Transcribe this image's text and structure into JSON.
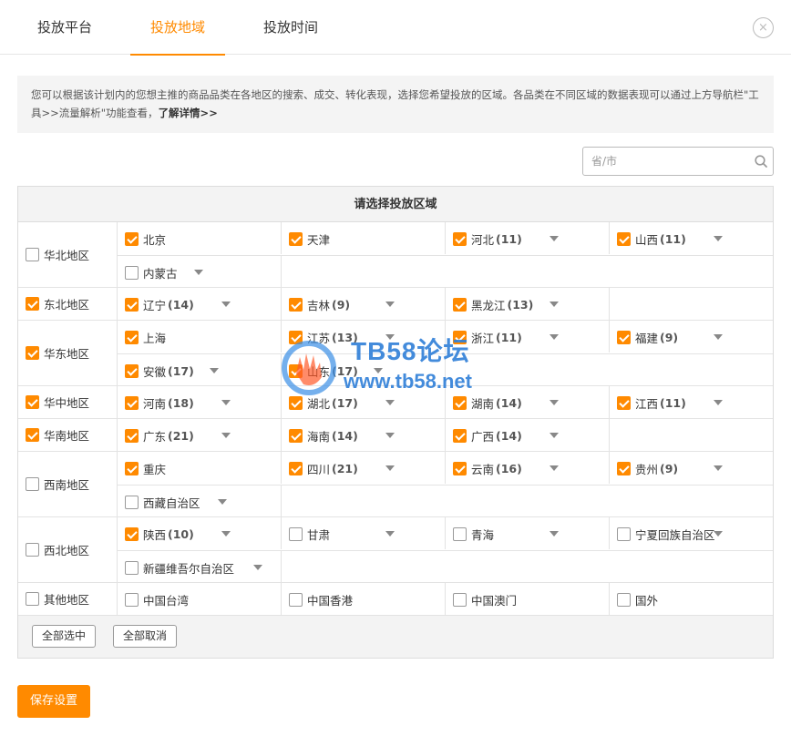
{
  "tabs": [
    {
      "label": "投放平台"
    },
    {
      "label": "投放地域"
    },
    {
      "label": "投放时间"
    }
  ],
  "close_label": "×",
  "notice": {
    "text": "您可以根据该计划内的您想主推的商品品类在各地区的搜索、成交、转化表现，选择您希望投放的区域。各品类在不同区域的数据表现可以通过上方导航栏\"工具>>流量解析\"功能查看，",
    "link": "了解详情>>"
  },
  "search": {
    "placeholder": "省/市",
    "value": ""
  },
  "table": {
    "header": "请选择投放区域",
    "regions": [
      {
        "name": "华北地区",
        "checked": false,
        "provinces": [
          {
            "name": "北京",
            "count": "",
            "checked": true,
            "dropdown": false
          },
          {
            "name": "天津",
            "count": "",
            "checked": true,
            "dropdown": false
          },
          {
            "name": "河北",
            "count": "(11)",
            "checked": true,
            "dropdown": true
          },
          {
            "name": "山西",
            "count": "(11)",
            "checked": true,
            "dropdown": true
          },
          {
            "name": "内蒙古",
            "count": "",
            "checked": false,
            "dropdown": true
          }
        ]
      },
      {
        "name": "东北地区",
        "checked": true,
        "provinces": [
          {
            "name": "辽宁",
            "count": "(14)",
            "checked": true,
            "dropdown": true
          },
          {
            "name": "吉林",
            "count": "(9)",
            "checked": true,
            "dropdown": true
          },
          {
            "name": "黑龙江",
            "count": "(13)",
            "checked": true,
            "dropdown": true
          }
        ]
      },
      {
        "name": "华东地区",
        "checked": true,
        "provinces": [
          {
            "name": "上海",
            "count": "",
            "checked": true,
            "dropdown": false
          },
          {
            "name": "江苏",
            "count": "(13)",
            "checked": true,
            "dropdown": true
          },
          {
            "name": "浙江",
            "count": "(11)",
            "checked": true,
            "dropdown": true
          },
          {
            "name": "福建",
            "count": "(9)",
            "checked": true,
            "dropdown": true
          },
          {
            "name": "安徽",
            "count": "(17)",
            "checked": true,
            "dropdown": true
          },
          {
            "name": "山东",
            "count": "(17)",
            "checked": true,
            "dropdown": true
          }
        ]
      },
      {
        "name": "华中地区",
        "checked": true,
        "provinces": [
          {
            "name": "河南",
            "count": "(18)",
            "checked": true,
            "dropdown": true
          },
          {
            "name": "湖北",
            "count": "(17)",
            "checked": true,
            "dropdown": true
          },
          {
            "name": "湖南",
            "count": "(14)",
            "checked": true,
            "dropdown": true
          },
          {
            "name": "江西",
            "count": "(11)",
            "checked": true,
            "dropdown": true
          }
        ]
      },
      {
        "name": "华南地区",
        "checked": true,
        "provinces": [
          {
            "name": "广东",
            "count": "(21)",
            "checked": true,
            "dropdown": true
          },
          {
            "name": "海南",
            "count": "(14)",
            "checked": true,
            "dropdown": true
          },
          {
            "name": "广西",
            "count": "(14)",
            "checked": true,
            "dropdown": true
          }
        ]
      },
      {
        "name": "西南地区",
        "checked": false,
        "provinces": [
          {
            "name": "重庆",
            "count": "",
            "checked": true,
            "dropdown": false
          },
          {
            "name": "四川",
            "count": "(21)",
            "checked": true,
            "dropdown": true
          },
          {
            "name": "云南",
            "count": "(16)",
            "checked": true,
            "dropdown": true
          },
          {
            "name": "贵州",
            "count": "(9)",
            "checked": true,
            "dropdown": true
          },
          {
            "name": "西藏自治区",
            "count": "",
            "checked": false,
            "dropdown": true
          }
        ]
      },
      {
        "name": "西北地区",
        "checked": false,
        "provinces": [
          {
            "name": "陕西",
            "count": "(10)",
            "checked": true,
            "dropdown": true
          },
          {
            "name": "甘肃",
            "count": "",
            "checked": false,
            "dropdown": true
          },
          {
            "name": "青海",
            "count": "",
            "checked": false,
            "dropdown": true
          },
          {
            "name": "宁夏回族自治区",
            "count": "",
            "checked": false,
            "dropdown": true
          },
          {
            "name": "新疆维吾尔自治区",
            "count": "",
            "checked": false,
            "dropdown": true
          }
        ]
      },
      {
        "name": "其他地区",
        "checked": false,
        "provinces": [
          {
            "name": "中国台湾",
            "count": "",
            "checked": false,
            "dropdown": false
          },
          {
            "name": "中国香港",
            "count": "",
            "checked": false,
            "dropdown": false
          },
          {
            "name": "中国澳门",
            "count": "",
            "checked": false,
            "dropdown": false
          },
          {
            "name": "国外",
            "count": "",
            "checked": false,
            "dropdown": false
          }
        ]
      }
    ],
    "select_all_label": "全部选中",
    "deselect_all_label": "全部取消"
  },
  "save_label": "保存设置",
  "watermark": {
    "title": "TB58论坛",
    "url": "www.tb58.net"
  },
  "colors": {
    "accent": "#ff8a00",
    "watermark": "#2f7fd8"
  }
}
